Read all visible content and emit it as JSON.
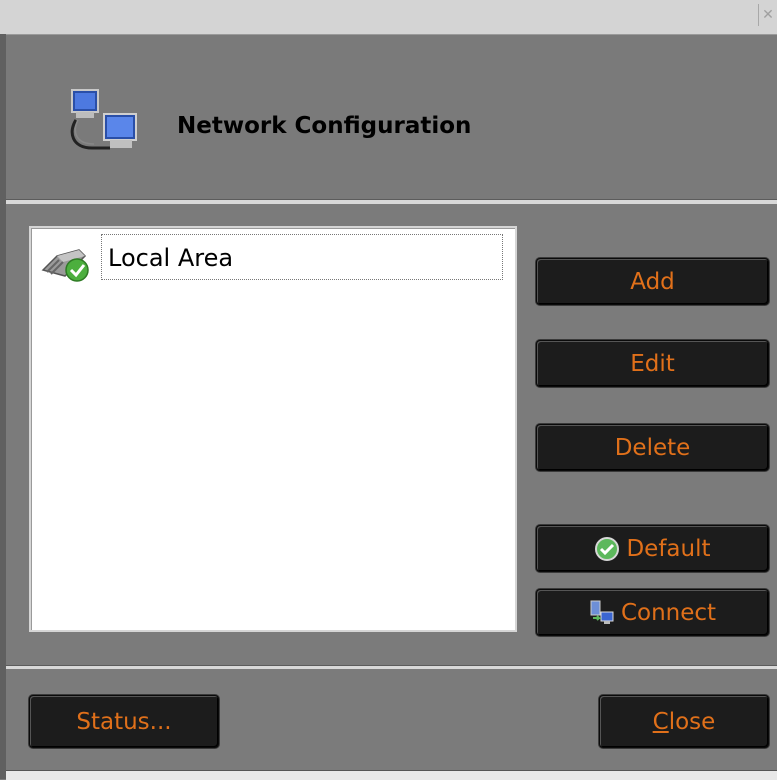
{
  "window": {
    "title": "Network Configuration",
    "close_glyph": "✕"
  },
  "list": {
    "items": [
      {
        "label": "Local Area",
        "icon": "network-cable-check-icon"
      }
    ]
  },
  "buttons": {
    "add": "Add",
    "edit": "Edit",
    "delete": "Delete",
    "default": "Default",
    "connect": "Connect",
    "status": "Status...",
    "close": "Close"
  },
  "icons": {
    "header": "network-computers-icon",
    "default": "check-circle-icon",
    "connect": "connect-computers-icon"
  },
  "colors": {
    "button_text": "#e0701a",
    "button_bg": "#1c1c1c",
    "dialog_bg": "#7b7b7b",
    "list_bg": "#ffffff"
  }
}
